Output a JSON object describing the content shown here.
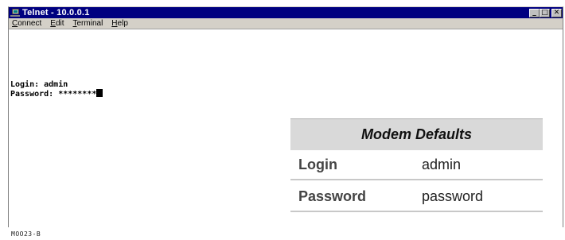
{
  "window": {
    "title": "Telnet - 10.0.0.1",
    "controls": {
      "minimize": "_",
      "maximize": "□",
      "close": "✕"
    }
  },
  "menu": [
    {
      "label_ul": "C",
      "label_rest": "onnect"
    },
    {
      "label_ul": "E",
      "label_rest": "dit"
    },
    {
      "label_ul": "T",
      "label_rest": "erminal"
    },
    {
      "label_ul": "H",
      "label_rest": "elp"
    }
  ],
  "terminal": {
    "line1": "Login: admin",
    "line2": "Password: ********"
  },
  "defaults": {
    "title": "Modem Defaults",
    "rows": [
      {
        "key": "Login",
        "value": "admin"
      },
      {
        "key": "Password",
        "value": "password"
      }
    ]
  },
  "figure_code": "MOO23-B",
  "colors": {
    "titlebar": "#000080",
    "menubar": "#d4d0c8",
    "table_header": "#d9d9d9"
  },
  "icons": [
    "telnet-app-icon",
    "minimize-icon",
    "maximize-icon",
    "close-icon"
  ]
}
